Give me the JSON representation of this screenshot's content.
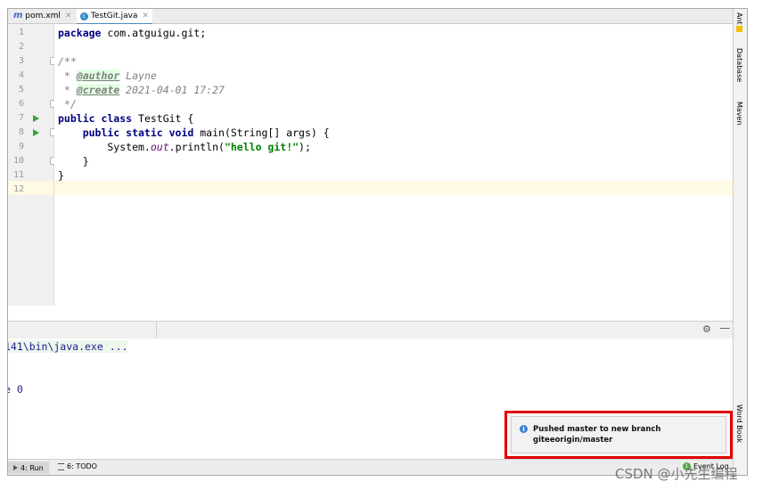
{
  "tabs": [
    {
      "label": "pom.xml",
      "icon": "maven-file-icon"
    },
    {
      "label": "TestGit.java",
      "icon": "java-class-icon"
    }
  ],
  "line_numbers": [
    "1",
    "2",
    "3",
    "4",
    "5",
    "6",
    "7",
    "8",
    "9",
    "10",
    "11",
    "12"
  ],
  "code": {
    "l1_kw": "package",
    "l1_rest": " com.atguigu.git;",
    "l3": "/**",
    "l4_star": " * ",
    "l4_tag": "@author",
    "l4_val": " Layne",
    "l5_star": " * ",
    "l5_tag": "@create",
    "l5_val": " 2021-04-01 17:27",
    "l6": " */",
    "l7_kw": "public class",
    "l7_rest": " TestGit {",
    "l8_kw": "    public static void",
    "l8_rest": " main(String[] args) {",
    "l9_a": "        System.",
    "l9_field": "out",
    "l9_b": ".println(",
    "l9_str": "\"hello git!\"",
    "l9_c": ");",
    "l10": "    }",
    "l11": "}"
  },
  "right_tools": [
    "Ant",
    "Database",
    "Maven",
    "Word Book"
  ],
  "console": {
    "line1": "141\\bin\\java.exe ...",
    "line2": "e 0"
  },
  "bottom_tools": {
    "run_label": "4: Run",
    "todo_label": "6: TODO",
    "event_log_label": "Event Log"
  },
  "notification": {
    "line1": "Pushed master to new branch",
    "line2": "giteeorigin/master"
  },
  "watermark": "CSDN @小先生编程"
}
